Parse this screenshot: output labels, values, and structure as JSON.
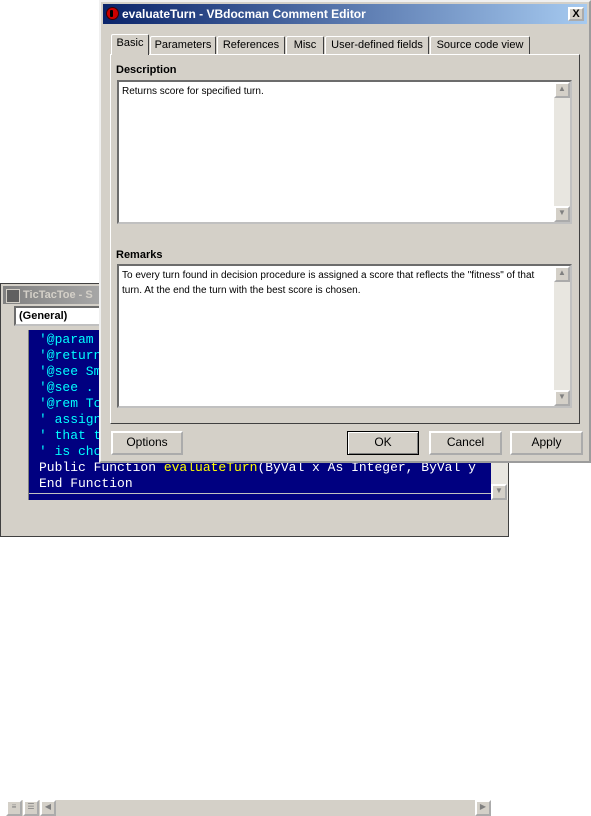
{
  "dialog": {
    "title": "evaluateTurn - VBdocman Comment Editor",
    "close_label": "X",
    "tabs": [
      "Basic",
      "Parameters",
      "References",
      "Misc",
      "User-defined fields",
      "Source code view"
    ],
    "description_label": "Description",
    "description_text": "Returns score for specified turn.",
    "remarks_label": "Remarks",
    "remarks_text": "To every turn found in decision procedure is  assigned a score that reflects the \"fitness\" of that turn. At the end the turn with the best score  is chosen.",
    "buttons": {
      "options": "Options",
      "ok": "OK",
      "cancel": "Cancel",
      "apply": "Apply"
    }
  },
  "code_window": {
    "title": "TicTacToe - S",
    "procedure_combo": "(General)",
    "lines": [
      "'@param",
      "'@return",
      "'@see Sm",
      "'@see .",
      "'@rem To",
      "' assign",
      "' that t",
      "' is cho"
    ],
    "signature_keyword": "Public Function ",
    "signature_name": "evaluateTurn",
    "signature_rest": "(ByVal x As Integer, ByVal y",
    "end_line": "End Function"
  }
}
